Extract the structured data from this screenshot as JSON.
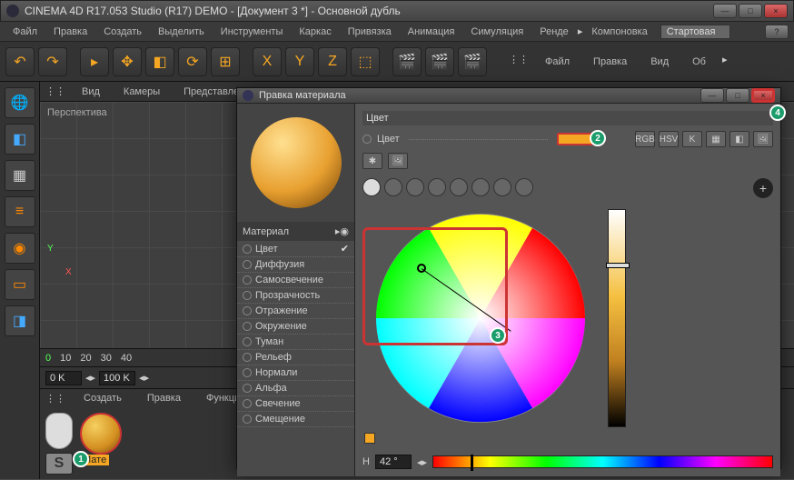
{
  "window": {
    "title": "CINEMA 4D R17.053 Studio (R17) DEMO - [Документ 3 *] - Основной дубль"
  },
  "menu": {
    "items": [
      "Файл",
      "Правка",
      "Создать",
      "Выделить",
      "Инструменты",
      "Каркас",
      "Привязка",
      "Анимация",
      "Симуляция",
      "Ренде",
      "Компоновка"
    ],
    "layout": "Стартовая"
  },
  "viewport": {
    "tabs": [
      "Вид",
      "Камеры",
      "Представление"
    ],
    "label": "Перспектива"
  },
  "timeline": {
    "marks": [
      "0",
      "10",
      "20",
      "30",
      "40"
    ],
    "start": "0 K",
    "end": "100 K"
  },
  "materials": {
    "tabs": [
      "Создать",
      "Правка",
      "Функции"
    ],
    "thumb_label": "Мате"
  },
  "dialog": {
    "title": "Правка материала",
    "preview_label": "Материал",
    "section": "Цвет",
    "row_label": "Цвет",
    "channels": [
      "Цвет",
      "Диффузия",
      "Самосвечение",
      "Прозрачность",
      "Отражение",
      "Окружение",
      "Туман",
      "Рельеф",
      "Нормали",
      "Альфа",
      "Свечение",
      "Смещение"
    ],
    "mode_buttons": [
      "RGB",
      "HSV",
      "K"
    ],
    "hue_label": "H",
    "hue_value": "42 °",
    "swatches": [
      "#f5a623",
      "#f5a623"
    ]
  },
  "right_menu": {
    "items": [
      "Файл",
      "Правка",
      "Вид",
      "Об"
    ]
  },
  "markers": {
    "m1": "1",
    "m2": "2",
    "m3": "3",
    "m4": "4"
  }
}
